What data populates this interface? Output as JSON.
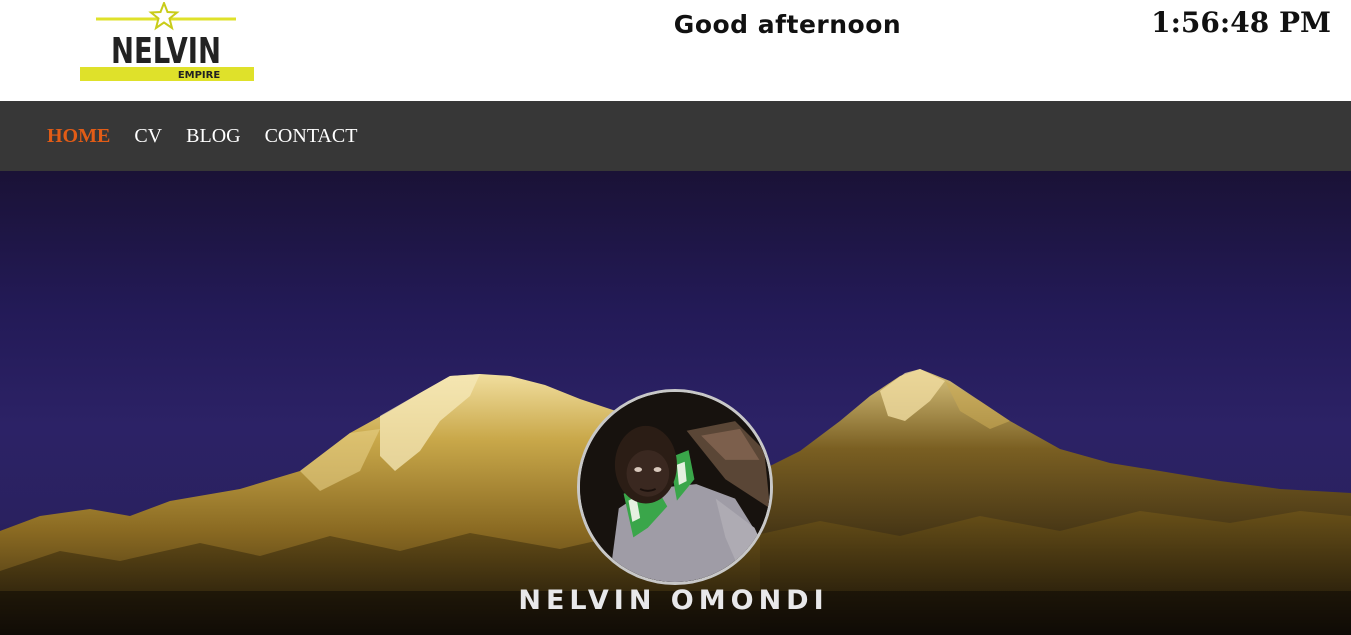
{
  "header": {
    "logo": {
      "main_text": "NELVIN",
      "sub_text": "EMPIRE",
      "icon": "star-icon",
      "accent_color": "#dfe12a"
    },
    "greeting": "Good afternoon",
    "clock": "1:56:48 PM"
  },
  "nav": {
    "items": [
      {
        "label": "HOME",
        "active": true
      },
      {
        "label": "CV",
        "active": false
      },
      {
        "label": "BLOG",
        "active": false
      },
      {
        "label": "CONTACT",
        "active": false
      }
    ],
    "background_color": "#373737",
    "active_color": "#e25c16"
  },
  "hero": {
    "name": "NELVIN OMONDI",
    "avatar_icon": "profile-photo",
    "background_image": "mountain-peaks-at-dusk"
  }
}
